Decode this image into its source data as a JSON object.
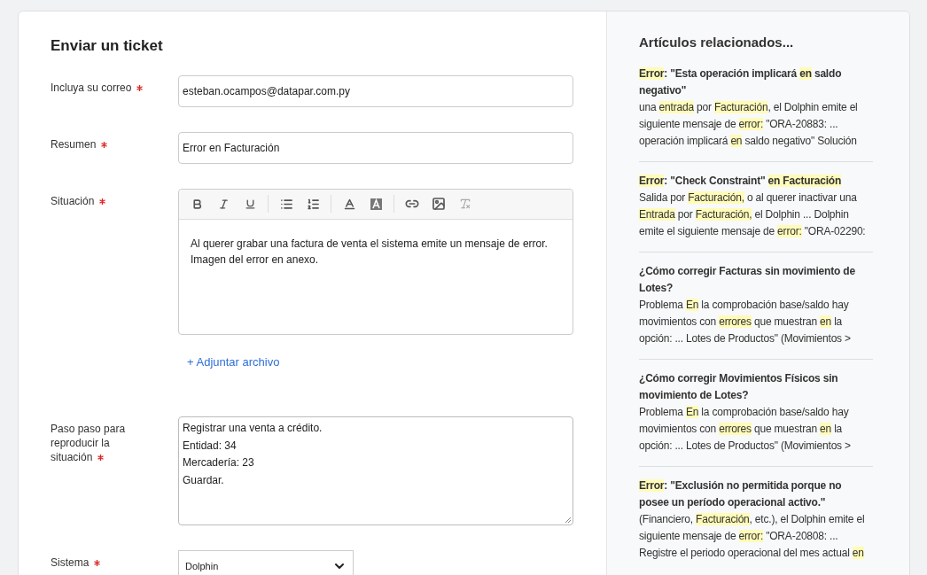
{
  "form": {
    "title": "Enviar un ticket",
    "fields": [
      {
        "kind": "input",
        "label": "Incluya su correo",
        "required": true,
        "value": "esteban.ocampos@datapar.com.py"
      },
      {
        "kind": "input",
        "label": "Resumen",
        "required": true,
        "value": "Error en Facturación"
      },
      {
        "kind": "editor",
        "label": "Situación",
        "required": true,
        "value": "Al querer grabar una factura de venta el sistema emite un mensaje de error.\nImagen del error en anexo.",
        "attach_link": "+ Adjuntar archivo"
      },
      {
        "kind": "textarea",
        "label": "Paso paso para reproducir la situación",
        "required": true,
        "value": "Registrar una venta a crédito.\nEntidad: 34\nMercadería: 23\nGuardar."
      },
      {
        "kind": "select",
        "label": "Sistema",
        "required": true,
        "value": "Dolphin"
      }
    ]
  },
  "related": {
    "title": "Artículos relacionados...",
    "articles": [
      {
        "title": [
          {
            "text": "Error",
            "highlight": true
          },
          {
            "text": ": \"Esta operación implicará ",
            "highlight": false
          },
          {
            "text": "en",
            "highlight": true
          },
          {
            "text": " saldo negativo\"",
            "highlight": false
          }
        ],
        "snippet": [
          {
            "text": "una ",
            "highlight": false
          },
          {
            "text": "entrada",
            "highlight": true
          },
          {
            "text": " por ",
            "highlight": false
          },
          {
            "text": "Facturación",
            "highlight": true
          },
          {
            "text": ", el Dolphin emite el siguiente mensaje de ",
            "highlight": false
          },
          {
            "text": "error:",
            "highlight": true
          },
          {
            "text": " \"ORA-20883: ... operación implicará ",
            "highlight": false
          },
          {
            "text": "en",
            "highlight": true
          },
          {
            "text": " saldo negativo\" Solución",
            "highlight": false
          }
        ]
      },
      {
        "title": [
          {
            "text": "Error",
            "highlight": true
          },
          {
            "text": ": \"Check Constraint\" ",
            "highlight": false
          },
          {
            "text": "en Facturación",
            "highlight": true
          }
        ],
        "snippet": [
          {
            "text": "Salida por ",
            "highlight": false
          },
          {
            "text": "Facturación,",
            "highlight": true
          },
          {
            "text": " o al querer inactivar una ",
            "highlight": false
          },
          {
            "text": "Entrada",
            "highlight": true
          },
          {
            "text": " por ",
            "highlight": false
          },
          {
            "text": "Facturación,",
            "highlight": true
          },
          {
            "text": " el Dolphin ... Dolphin emite el siguiente mensaje de ",
            "highlight": false
          },
          {
            "text": "error:",
            "highlight": true
          },
          {
            "text": " \"ORA-02290:",
            "highlight": false
          }
        ]
      },
      {
        "title": [
          {
            "text": "¿Cómo corregir Facturas sin movimiento de Lotes?",
            "highlight": false
          }
        ],
        "snippet": [
          {
            "text": "Problema ",
            "highlight": false
          },
          {
            "text": "En",
            "highlight": true
          },
          {
            "text": " la comprobación base/saldo hay movimientos con ",
            "highlight": false
          },
          {
            "text": "errores",
            "highlight": true
          },
          {
            "text": " que muestran ",
            "highlight": false
          },
          {
            "text": "en",
            "highlight": true
          },
          {
            "text": " la opción: ... Lotes de Productos\" (Movimientos >",
            "highlight": false
          }
        ]
      },
      {
        "title": [
          {
            "text": "¿Cómo corregir Movimientos Físicos sin movimiento de Lotes?",
            "highlight": false
          }
        ],
        "snippet": [
          {
            "text": "Problema ",
            "highlight": false
          },
          {
            "text": "En",
            "highlight": true
          },
          {
            "text": " la comprobación base/saldo hay movimientos con ",
            "highlight": false
          },
          {
            "text": "errores",
            "highlight": true
          },
          {
            "text": " que muestran ",
            "highlight": false
          },
          {
            "text": "en",
            "highlight": true
          },
          {
            "text": " la opción: ... Lotes de Productos\" (Movimientos >",
            "highlight": false
          }
        ]
      },
      {
        "title": [
          {
            "text": "Error",
            "highlight": true
          },
          {
            "text": ": \"Exclusión no permitida porque no posee un período operacional activo.\"",
            "highlight": false
          }
        ],
        "snippet": [
          {
            "text": "(Financiero, ",
            "highlight": false
          },
          {
            "text": "Facturación",
            "highlight": true
          },
          {
            "text": ", etc.), el Dolphin emite el siguiente mensaje de ",
            "highlight": false
          },
          {
            "text": "error:",
            "highlight": true
          },
          {
            "text": " \"ORA-20808: ... Registre el periodo operacional del mes actual ",
            "highlight": false
          },
          {
            "text": "en",
            "highlight": true
          }
        ]
      }
    ]
  }
}
